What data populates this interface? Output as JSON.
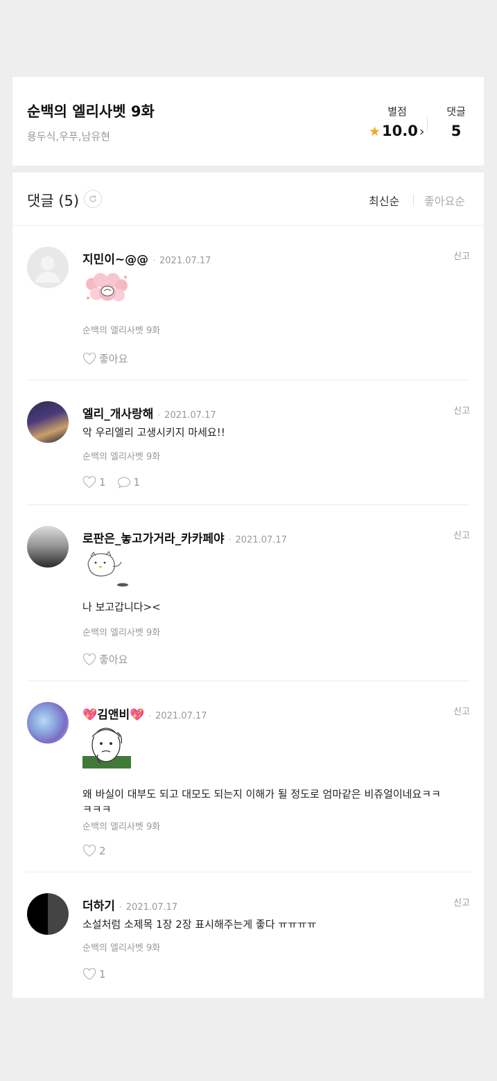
{
  "episode": {
    "title": "순백의 엘리사벳 9화",
    "authors": "용두식,우푸,남유현",
    "rating_label": "별점",
    "rating_value": "10.0",
    "comment_count_label": "댓글",
    "comment_count": "5"
  },
  "comments_section": {
    "title": "댓글 (5)",
    "sort_latest": "최신순",
    "sort_likes": "좋아요순"
  },
  "colors": {
    "star": "#f5a623",
    "background": "#eeeeee",
    "muted_text": "#999999"
  },
  "comments": [
    {
      "username": "지민이~@@",
      "date": "2021.07.17",
      "report": "신고",
      "text": "",
      "episode_ref": "순백의 엘리사벳 9화",
      "like": "좋아요",
      "reply": ""
    },
    {
      "username": "엘리_개사랑해",
      "date": "2021.07.17",
      "report": "신고",
      "text": "악 우리엘리 고생시키지 마세요!!",
      "episode_ref": "순백의 엘리사벳 9화",
      "like": "1",
      "reply": "1"
    },
    {
      "username": "로판은_놓고가거라_카카페야",
      "date": "2021.07.17",
      "report": "신고",
      "text": "나 보고갑니다><",
      "episode_ref": "순백의 엘리사벳 9화",
      "like": "좋아요",
      "reply": ""
    },
    {
      "username": "💖김앤비💖",
      "date": "2021.07.17",
      "report": "신고",
      "text": "왜 바실이 대부도 되고 대모도 되는지 이해가 될 정도로 엄마같은 비쥬얼이네요ㅋㅋㅋㅋㅋ",
      "episode_ref": "순백의 엘리사벳 9화",
      "like": "2",
      "reply": ""
    },
    {
      "username": "더하기",
      "date": "2021.07.17",
      "report": "신고",
      "text": "소설처럼 소제목 1장 2장 표시해주는게 좋다 ㅠㅠㅠㅠ",
      "episode_ref": "순백의 엘리사벳 9화",
      "like": "1",
      "reply": ""
    }
  ]
}
